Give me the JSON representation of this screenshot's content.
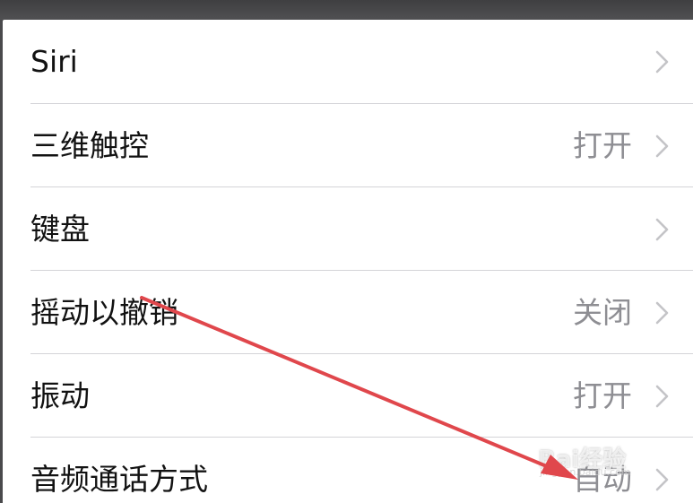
{
  "settings": {
    "rows": [
      {
        "label": "Siri",
        "value": ""
      },
      {
        "label": "三维触控",
        "value": "打开"
      },
      {
        "label": "键盘",
        "value": ""
      },
      {
        "label": "摇动以撤销",
        "value": "关闭"
      },
      {
        "label": "振动",
        "value": "打开"
      },
      {
        "label": "音频通话方式",
        "value": "自动"
      }
    ]
  },
  "annotation": {
    "arrow_color": "#e0474c"
  },
  "watermark": {
    "text": "Bai经验",
    "sub": "jingyan.baidu.com"
  },
  "colors": {
    "label": "#121212",
    "value": "#8e8e93",
    "chevron": "#c4c4c7",
    "separator": "#d4d4d8"
  }
}
